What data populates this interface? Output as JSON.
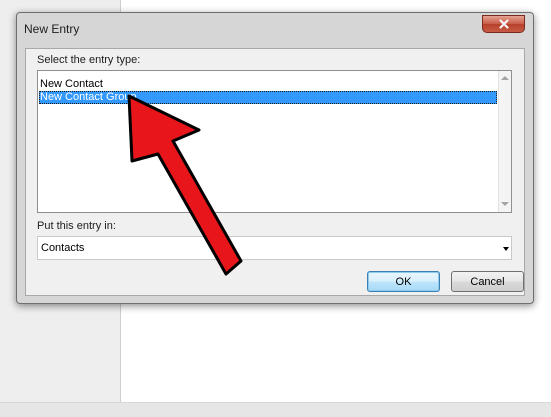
{
  "dialog": {
    "title": "New Entry",
    "entry_type_label": "Select the entry type:",
    "entry_types": [
      {
        "label": "New Contact",
        "selected": false
      },
      {
        "label": "New Contact Group",
        "selected": true
      }
    ],
    "location_label": "Put this entry in:",
    "location_value": "Contacts",
    "ok_label": "OK",
    "cancel_label": "Cancel"
  },
  "annotation": {
    "icon": "red-arrow-icon",
    "color": "#e8161b"
  },
  "colors": {
    "selection": "#3399ff",
    "close_button": "#c75b45"
  }
}
